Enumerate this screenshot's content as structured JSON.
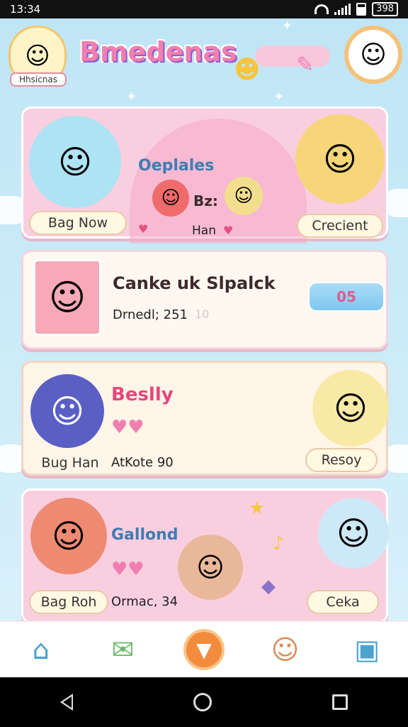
{
  "status": {
    "time": "13:34",
    "battery": "398"
  },
  "header": {
    "title": "Bmedenas",
    "avatar_label": "Hhsicnas"
  },
  "cards": [
    {
      "title": "Oeplales",
      "subtitle": "Bz:",
      "left_button": "Bag Now",
      "name_label": "Han",
      "right_button": "Crecient"
    },
    {
      "title": "Canke uk Slpalck",
      "meta": "Drnedl; 251",
      "meta_extra": "10",
      "counter": "05"
    },
    {
      "title": "Beslly",
      "left_button": "Bug Han",
      "meta": "AtKote 90",
      "right_button": "Resoy"
    },
    {
      "title": "Gallond",
      "left_button": "Bag Roh",
      "meta": "Ormac, 34",
      "right_button": "Ceka"
    }
  ],
  "icons": {
    "nav": [
      "home-icon",
      "gift-icon",
      "play-icon",
      "friends-icon",
      "chat-icon"
    ]
  },
  "colors": {
    "accent_pink": "#f07fb0",
    "card_pink": "#f9cfe0",
    "button_cream": "#fff8e2"
  }
}
